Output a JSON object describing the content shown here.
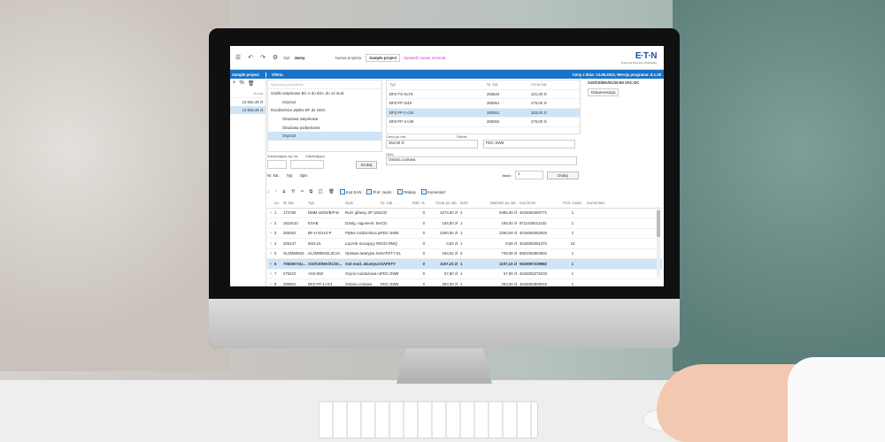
{
  "toolbar": {
    "style_label": "Styl:",
    "style_value": "Jasny",
    "project_label": "Nazwa projektu:",
    "project_value": "Sample project",
    "check_link": "Sprawdź nazwę nemeda"
  },
  "logo": {
    "main": "E·T·N",
    "tag": "Powering Business Worldwide"
  },
  "bluebar": {
    "left": "Sample project",
    "mid": "Oferta",
    "right": "Ceny z dnia: 13.06.2022, Wersja programu: 8.1.29"
  },
  "leftcol": {
    "head": "Suma",
    "rows": [
      "13 592,49 zł",
      "13 592,49 zł"
    ]
  },
  "tree": {
    "search_placeholder": "Wyszukaj produktów",
    "items": [
      {
        "label": "Szafki natynkowe BC-A do 63A; do 13 mod.",
        "level": 1
      },
      {
        "label": "Ozprzęt",
        "level": 2
      },
      {
        "label": "Rozdzielnice płytkie BF do 160A",
        "level": 1
      },
      {
        "label": "Obudowa natynkowa",
        "level": 2
      },
      {
        "label": "Obudowa podtynkowa",
        "level": 2
      },
      {
        "label": "Osprzęt",
        "level": 2
      }
    ]
  },
  "search": {
    "start_label": "Zaczynający się na:",
    "contains_label": "Zawierający:",
    "search_button": "Szukaj",
    "radio_cat": "Nr. kat.",
    "radio_type": "Typ",
    "radio_desc": "Opis"
  },
  "prodtable": {
    "headers": [
      "Typ",
      "Nr. kat.",
      "Cena kat."
    ],
    "rows": [
      [
        "BFZ-TS-KLT9",
        "293634",
        "221,00 zł"
      ],
      [
        "BFZ-FP-2/48",
        "283061",
        "275,00 zł"
      ],
      [
        "BFZ-FP-1+/24",
        "283061",
        "253,00 zł"
      ],
      [
        "BFZ-FP-2+/48",
        "283062",
        "279,00 zł"
      ]
    ]
  },
  "form": {
    "price_label": "Cena po rab.:",
    "price_value": "253,00 zł",
    "discount_label": "Rabat:",
    "discount_value": "PDC-SWB",
    "desc_label": "Opis:",
    "desc_value": "Osłona czołowa",
    "qty_label": "Ilość:",
    "qty_value": "1",
    "add_button": "Dodaj"
  },
  "rightpane": {
    "title": "X10/CE/MA/01/10-60 VAC-DC",
    "doc_button": "Dokumentacja"
  },
  "midbar": {
    "checks": [
      "Kod EAN",
      "Prof. zaokr.",
      "Rabaty",
      "Komentarz"
    ]
  },
  "grid": {
    "headers": [
      "Lp.",
      "Nr kat.",
      "Typ",
      "Opis",
      "Gr. rab.",
      "Rab. %",
      "Cena po rab.",
      "Ilość",
      "Wartość po rab.",
      "Kod EAN",
      "Prof. zaokr.",
      "Komentarz"
    ],
    "rows": [
      [
        "1",
        "172780",
        "DMM-160/3/B/P-B",
        "Rozł. główny 3P 160A, blok...",
        "ICD",
        "0",
        "2274,00 zł",
        "4",
        "9496,00 zł",
        "4015081693771",
        "1",
        ""
      ],
      [
        "2",
        "1810010",
        "ESAB",
        "Dzwig. ragument. bezp. t...",
        "ICD",
        "0",
        "165,00 zł",
        "1",
        "165,00 zł",
        "8711428011432",
        "1",
        ""
      ],
      [
        "3",
        "285352",
        "BF-U-6/144-P",
        "Płytka rozdzielnica podty...",
        "PDC-SWB",
        "0",
        "2260,00 zł",
        "1",
        "2260,00 zł",
        "4015082053525",
        "1",
        ""
      ],
      [
        "4",
        "206137",
        "M22-L5",
        "Łącznik mocujący RMQ-t...",
        "ICD-RMQ",
        "0",
        "0,84 zł",
        "1",
        "8,69 zł",
        "4015082061372",
        "10",
        ""
      ],
      [
        "5",
        "SLZMMM42...",
        "SLZMMM42L3C2A",
        "Oprawa awaryjna Safeti...",
        "SAFETY EL",
        "0",
        "184,52 zł",
        "4",
        "738,08 zł",
        "5601064804502",
        "1",
        ""
      ],
      [
        "6",
        "70925071U...",
        "X10/CE/MA/01/10...",
        "X10 mod. akustyczny, cz...",
        "SAFETY",
        "0",
        "1157,23 zł",
        "1",
        "1157,23 zł",
        "5618087239882",
        "1",
        ""
      ],
      [
        "7",
        "275223",
        "ASS-650",
        "Szyna montażowa na do...",
        "PDC-SWB",
        "0",
        "57,90 zł",
        "1",
        "57,90 zł",
        "4015082275233",
        "1",
        ""
      ],
      [
        "8",
        "280801",
        "BFZ-FP-1+/24",
        "Osłona czołowa",
        "PDC-SWB",
        "0",
        "253,00 zł",
        "1",
        "253,00 zł",
        "4015082808015",
        "1",
        ""
      ]
    ],
    "selected_index": 5
  },
  "icons": {
    "delete": "x-icon"
  }
}
